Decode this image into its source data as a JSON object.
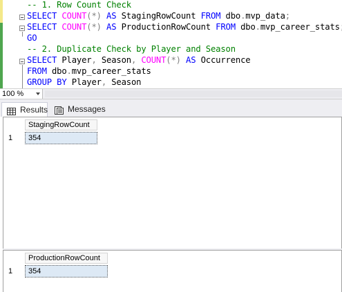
{
  "editor": {
    "lines": [
      {
        "tokens": [
          {
            "c": "cm",
            "t": "-- 1. Row Count Check"
          }
        ]
      },
      {
        "tokens": [
          {
            "c": "kw",
            "t": "SELECT "
          },
          {
            "c": "fn",
            "t": "COUNT"
          },
          {
            "c": "op",
            "t": "(*)"
          },
          {
            "c": "kw",
            "t": " AS "
          },
          {
            "c": "tx",
            "t": "StagingRowCount "
          },
          {
            "c": "kw",
            "t": "FROM "
          },
          {
            "c": "tx",
            "t": "dbo"
          },
          {
            "c": "op",
            "t": "."
          },
          {
            "c": "tx",
            "t": "mvp_data"
          },
          {
            "c": "op",
            "t": ";"
          }
        ]
      },
      {
        "tokens": [
          {
            "c": "kw",
            "t": "SELECT "
          },
          {
            "c": "fn",
            "t": "COUNT"
          },
          {
            "c": "op",
            "t": "(*)"
          },
          {
            "c": "kw",
            "t": " AS "
          },
          {
            "c": "tx",
            "t": "ProductionRowCount "
          },
          {
            "c": "kw",
            "t": "FROM "
          },
          {
            "c": "tx",
            "t": "dbo"
          },
          {
            "c": "op",
            "t": "."
          },
          {
            "c": "tx",
            "t": "mvp_career_stats"
          },
          {
            "c": "op",
            "t": ";"
          }
        ]
      },
      {
        "tokens": [
          {
            "c": "kw",
            "t": "GO"
          }
        ]
      },
      {
        "tokens": [
          {
            "c": "cm",
            "t": "-- 2. Duplicate Check by Player and Season"
          }
        ]
      },
      {
        "tokens": [
          {
            "c": "kw",
            "t": "SELECT "
          },
          {
            "c": "tx",
            "t": "Player"
          },
          {
            "c": "op",
            "t": ", "
          },
          {
            "c": "tx",
            "t": "Season"
          },
          {
            "c": "op",
            "t": ", "
          },
          {
            "c": "fn",
            "t": "COUNT"
          },
          {
            "c": "op",
            "t": "(*)"
          },
          {
            "c": "kw",
            "t": " AS "
          },
          {
            "c": "tx",
            "t": "Occurrence"
          }
        ]
      },
      {
        "tokens": [
          {
            "c": "kw",
            "t": "FROM "
          },
          {
            "c": "tx",
            "t": "dbo"
          },
          {
            "c": "op",
            "t": "."
          },
          {
            "c": "tx",
            "t": "mvp_career_stats"
          }
        ]
      },
      {
        "tokens": [
          {
            "c": "kw",
            "t": "GROUP BY "
          },
          {
            "c": "tx",
            "t": "Player"
          },
          {
            "c": "op",
            "t": ", "
          },
          {
            "c": "tx",
            "t": "Season"
          }
        ]
      }
    ]
  },
  "zoom": {
    "value": "100 %"
  },
  "tabs": {
    "results_label": "Results",
    "messages_label": "Messages"
  },
  "results": [
    {
      "header": "StagingRowCount",
      "row_number": "1",
      "value": "354"
    },
    {
      "header": "ProductionRowCount",
      "row_number": "1",
      "value": "354"
    }
  ],
  "colors": {
    "keyword": "#0000ff",
    "function": "#ff00ff",
    "comment": "#008000",
    "selected_cell": "#dde9f5"
  }
}
